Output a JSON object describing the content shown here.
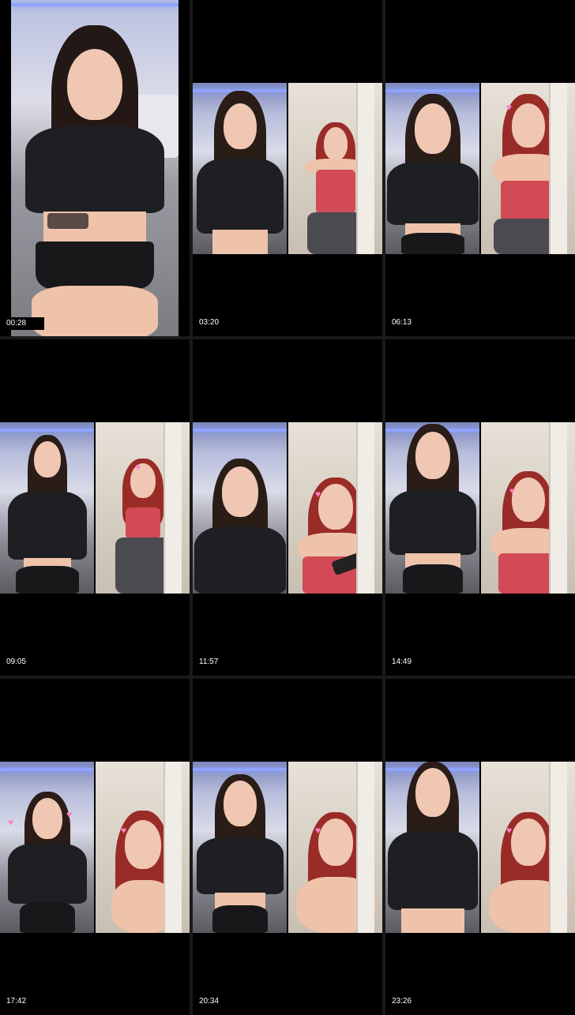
{
  "thumbnails": [
    {
      "timestamp": "00:28"
    },
    {
      "timestamp": "03:20"
    },
    {
      "timestamp": "06:13"
    },
    {
      "timestamp": "09:05"
    },
    {
      "timestamp": "11:57"
    },
    {
      "timestamp": "14:49"
    },
    {
      "timestamp": "17:42"
    },
    {
      "timestamp": "20:34"
    },
    {
      "timestamp": "23:26"
    }
  ],
  "colors": {
    "background": "#000000",
    "gutter": "#1a1a1a",
    "timestamp_text": "#ffffff",
    "shirt_black": "#1e1f22",
    "top_red": "#d24a55",
    "hair_dark": "#2a1c17",
    "hair_red": "#9a2c28"
  }
}
